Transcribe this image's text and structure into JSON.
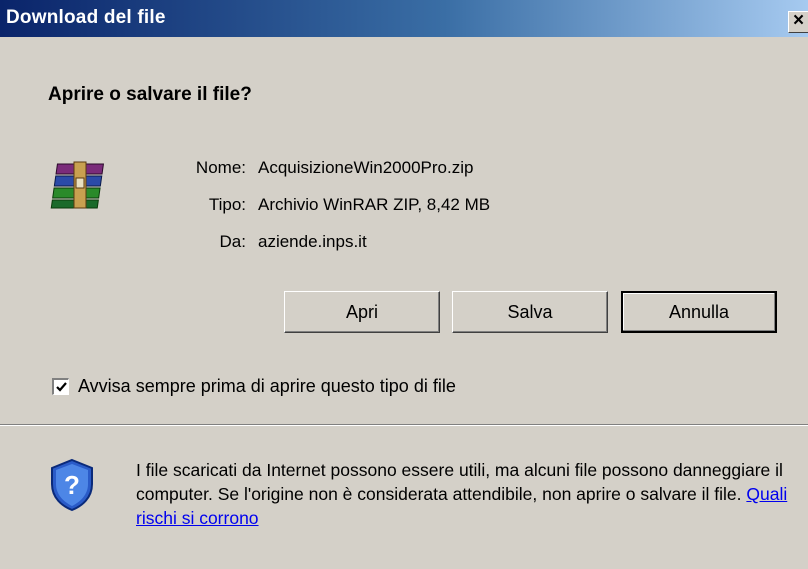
{
  "window": {
    "title": "Download del file",
    "close_glyph": "×"
  },
  "heading": "Aprire o salvare il file?",
  "file": {
    "icon": "winrar-archive-icon",
    "fields": [
      {
        "label": "Nome:",
        "value": "AcquisizioneWin2000Pro.zip"
      },
      {
        "label": "Tipo:",
        "value": "Archivio WinRAR ZIP, 8,42 MB"
      },
      {
        "label": "Da:",
        "value": "aziende.inps.it"
      }
    ]
  },
  "buttons": {
    "open": "Apri",
    "save": "Salva",
    "cancel": "Annulla"
  },
  "checkbox": {
    "checked": true,
    "label": "Avvisa sempre prima di aprire questo tipo di file"
  },
  "warning": {
    "icon": "shield-question-icon",
    "text": "I file scaricati da Internet possono essere utili, ma alcuni file possono danneggiare il computer. Se l'origine non è considerata attendibile, non aprire o salvare il file.",
    "link": "Quali rischi si corrono"
  },
  "colors": {
    "title_bar_start": "#0a246a",
    "title_bar_end": "#a6caf0",
    "face": "#d4d0c8",
    "link": "#0000ee"
  }
}
